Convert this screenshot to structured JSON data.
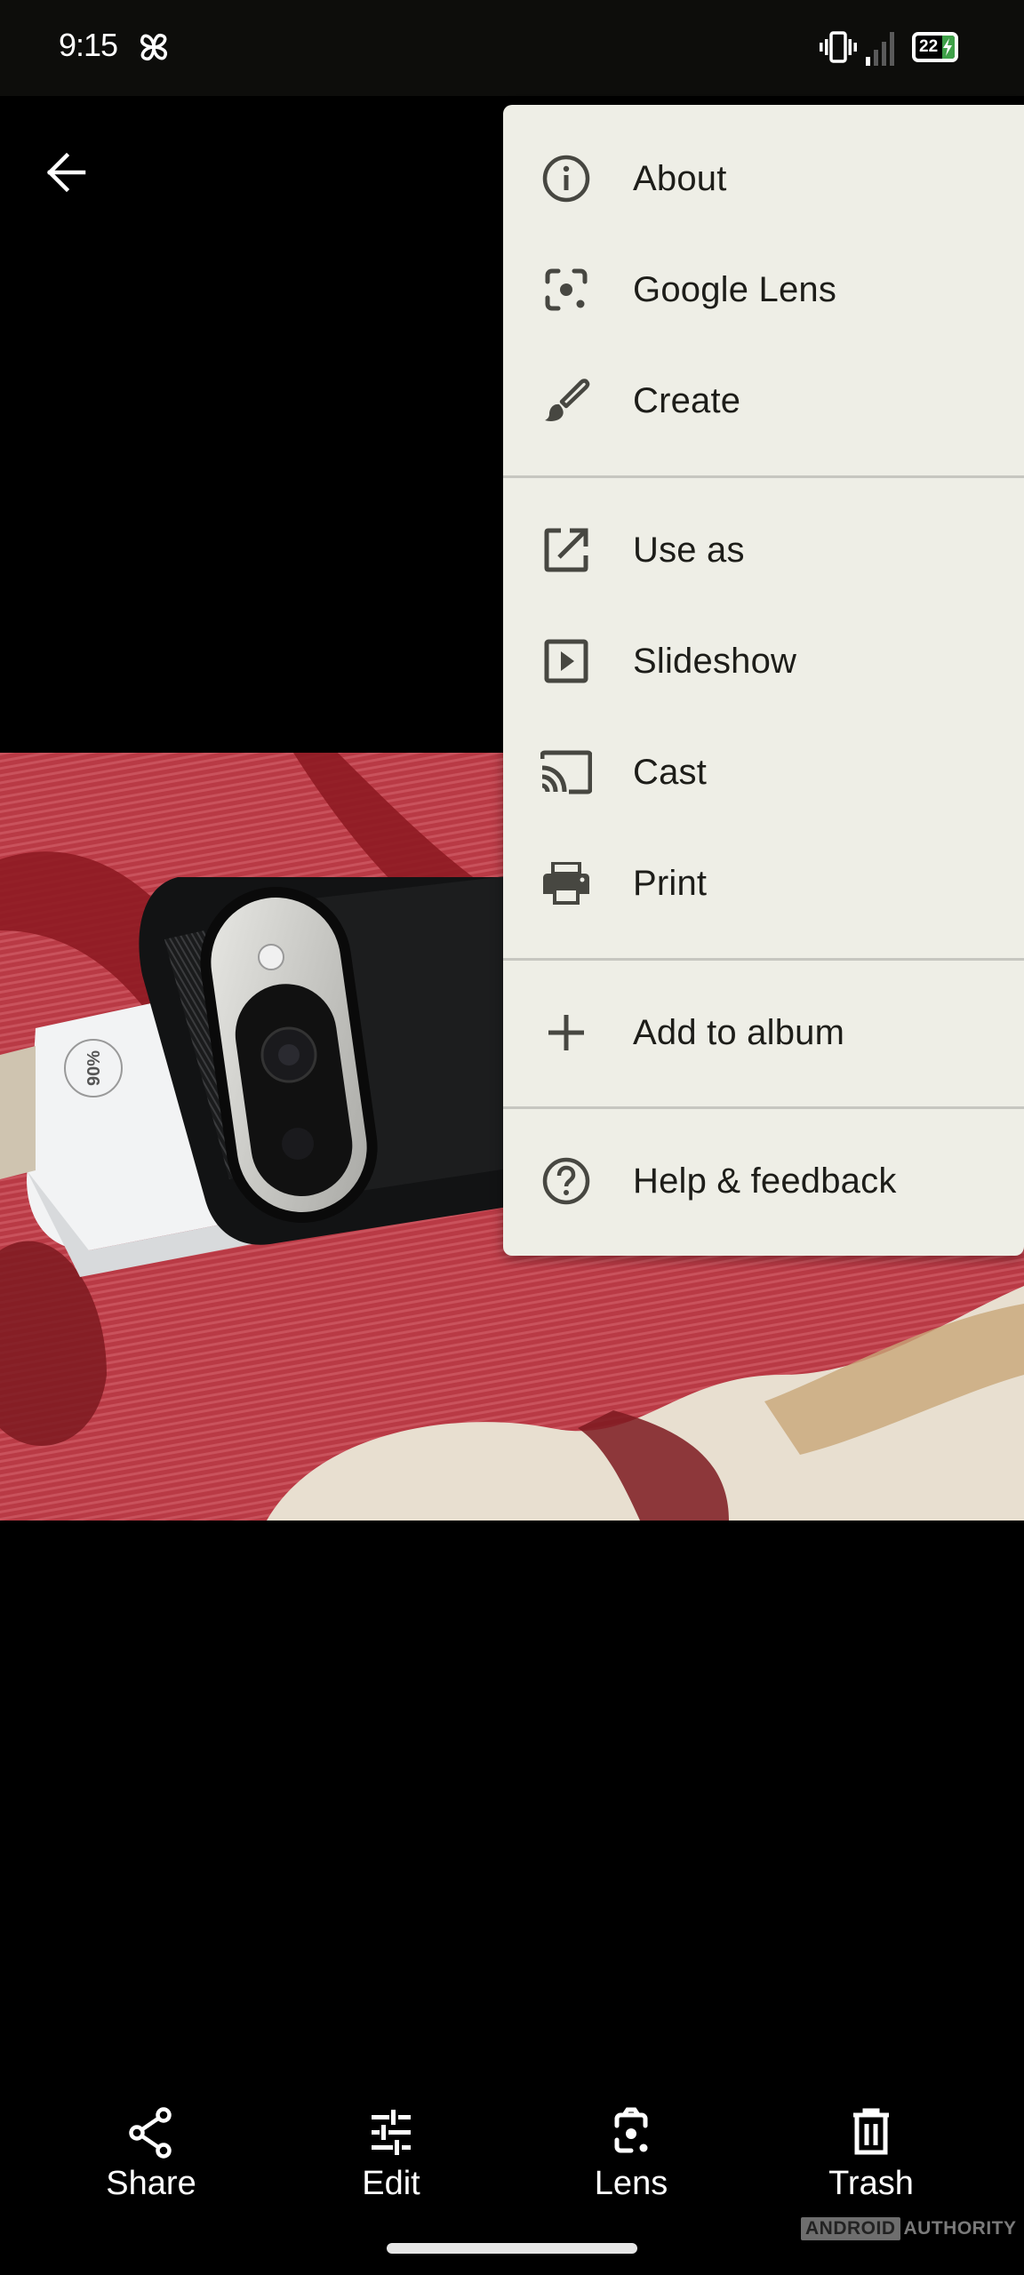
{
  "status_bar": {
    "time": "9:15",
    "notification_icon": "pinwheel-icon",
    "vibrate_icon": "vibrate-icon",
    "signal_icon": "cell-signal-icon",
    "signal_bars_active": 1,
    "signal_bars_total": 4,
    "battery_percent": "22",
    "battery_charging": true,
    "battery_color": "#3ea048"
  },
  "toolbar": {
    "back_icon": "arrow-back-icon"
  },
  "photo": {
    "description": "Black phone case with camera bar on a white box, on red and cream floral fabric",
    "box_text": "90%"
  },
  "overflow_menu": {
    "background": "#eeeee6",
    "groups": [
      [
        {
          "label": "About",
          "icon": "info-icon"
        },
        {
          "label": "Google Lens",
          "icon": "google-lens-icon"
        },
        {
          "label": "Create",
          "icon": "brush-icon"
        }
      ],
      [
        {
          "label": "Use as",
          "icon": "open-in-new-icon"
        },
        {
          "label": "Slideshow",
          "icon": "slideshow-icon"
        },
        {
          "label": "Cast",
          "icon": "cast-icon"
        },
        {
          "label": "Print",
          "icon": "print-icon"
        }
      ],
      [
        {
          "label": "Add to album",
          "icon": "add-icon"
        }
      ],
      [
        {
          "label": "Help & feedback",
          "icon": "help-icon"
        }
      ]
    ]
  },
  "bottom_actions": [
    {
      "label": "Share",
      "icon": "share-icon"
    },
    {
      "label": "Edit",
      "icon": "tune-icon"
    },
    {
      "label": "Lens",
      "icon": "lens-icon"
    },
    {
      "label": "Trash",
      "icon": "trash-icon"
    }
  ],
  "watermark": {
    "boxed": "ANDROID",
    "text": "AUTHORITY"
  }
}
